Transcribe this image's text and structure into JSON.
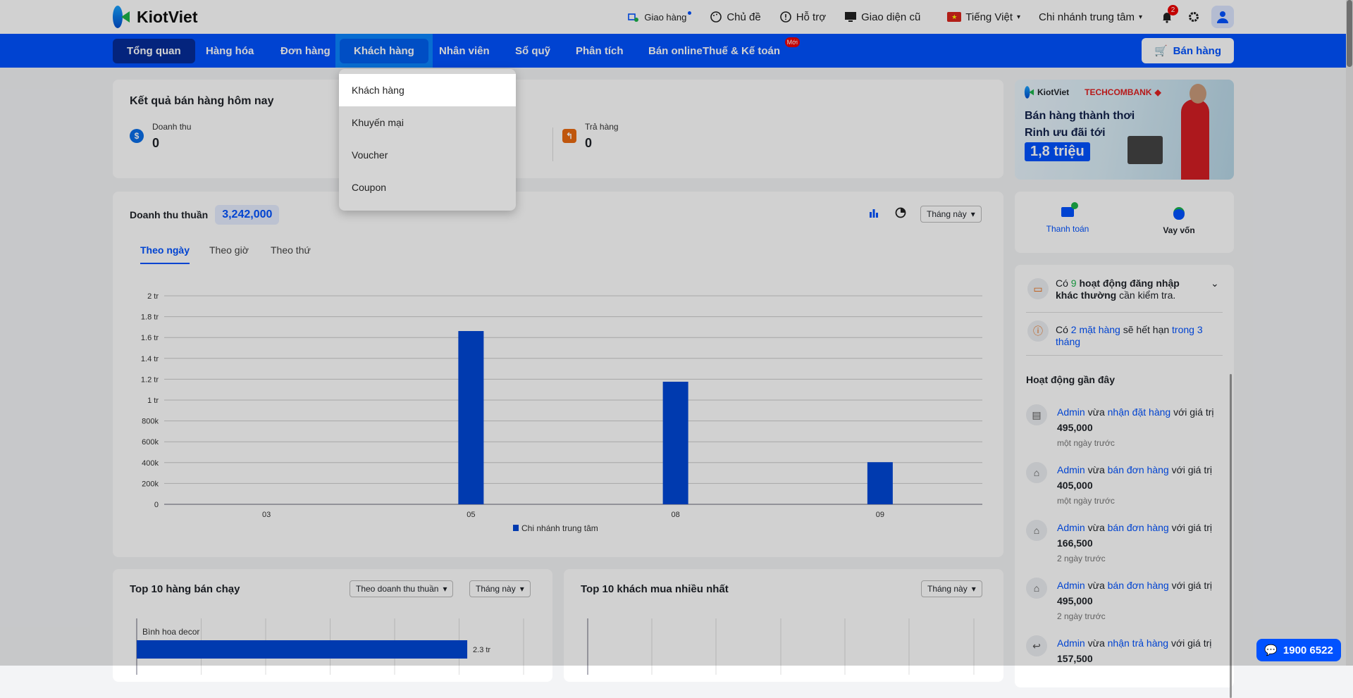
{
  "brand": "KiotViet",
  "topbar": {
    "delivery": "Giao hàng",
    "theme": "Chủ đề",
    "support": "Hỗ trợ",
    "old_ui": "Giao diện cũ",
    "language": "Tiếng Việt",
    "branch": "Chi nhánh trung tâm",
    "notifications": "2"
  },
  "nav": {
    "tabs": [
      "Tổng quan",
      "Hàng hóa",
      "Đơn hàng",
      "Khách hàng",
      "Nhân viên",
      "Sổ quỹ",
      "Phân tích",
      "Bán online",
      "Thuế & Kế toán"
    ],
    "new_badge": "Mới",
    "sell_button": "Bán hàng"
  },
  "dropdown": [
    "Khách hàng",
    "Khuyến mại",
    "Voucher",
    "Coupon"
  ],
  "today": {
    "title": "Kết quả bán hàng hôm nay",
    "revenue_label": "Doanh thu",
    "revenue": "0",
    "returns_label": "Trả hàng",
    "returns": "0"
  },
  "revenue": {
    "title": "Doanh thu thuần",
    "amount": "3,242,000",
    "period": "Tháng này",
    "tabs": [
      "Theo ngày",
      "Theo giờ",
      "Theo thứ"
    ]
  },
  "chart_data": {
    "type": "bar",
    "categories": [
      "03",
      "05",
      "08",
      "09"
    ],
    "series": [
      {
        "name": "Chi nhánh trung tâm",
        "values": [
          0,
          1662000,
          1176000,
          404000
        ]
      }
    ],
    "yticks": [
      "0",
      "200k",
      "400k",
      "600k",
      "800k",
      "1 tr",
      "1.2 tr",
      "1.4 tr",
      "1.6 tr",
      "1.8 tr",
      "2 tr"
    ],
    "ylim": [
      0,
      2000000
    ],
    "legend": "bottom",
    "color": "#0047d6"
  },
  "top_products": {
    "title": "Top 10 hàng bán chạy",
    "sort": "Theo doanh thu thuần",
    "period": "Tháng này",
    "chart_data": {
      "type": "bar",
      "categories": [
        "Bình hoa decor"
      ],
      "values": [
        2300000
      ],
      "labels": [
        "2.3 tr"
      ]
    }
  },
  "top_customers": {
    "title": "Top 10 khách mua nhiều nhất",
    "period": "Tháng này"
  },
  "banner": {
    "brand1": "KiotViet",
    "brand2": "TECHCOMBANK",
    "line1": "Bán hàng thành thơi",
    "line2": "Rinh ưu đãi tới",
    "offer": "1,8 triệu"
  },
  "finance": {
    "payment": "Thanh toán",
    "loan": "Vay vốn"
  },
  "alerts": {
    "login_pre": "Có",
    "login_count": "9",
    "login_bold": "hoạt động đăng nhập khác thường",
    "login_post": "cần kiểm tra.",
    "expire_pre": "Có",
    "expire_link": "2 mặt hàng",
    "expire_mid": "sẽ hết hạn",
    "expire_link2": "trong 3 tháng"
  },
  "activity": {
    "title": "Hoạt động gần đây",
    "items": [
      {
        "user": "Admin",
        "verb": "vừa",
        "action": "nhận đặt hàng",
        "mid": "với giá trị",
        "value": "495,000",
        "time": "một ngày trước"
      },
      {
        "user": "Admin",
        "verb": "vừa",
        "action": "bán đơn hàng",
        "mid": "với giá trị",
        "value": "405,000",
        "time": "một ngày trước"
      },
      {
        "user": "Admin",
        "verb": "vừa",
        "action": "bán đơn hàng",
        "mid": "với giá trị",
        "value": "166,500",
        "time": "2 ngày trước"
      },
      {
        "user": "Admin",
        "verb": "vừa",
        "action": "bán đơn hàng",
        "mid": "với giá trị",
        "value": "495,000",
        "time": "2 ngày trước"
      },
      {
        "user": "Admin",
        "verb": "vừa",
        "action": "nhận trả hàng",
        "mid": "với giá trị",
        "value": "157,500",
        "time": ""
      }
    ]
  },
  "hotline": "1900 6522"
}
